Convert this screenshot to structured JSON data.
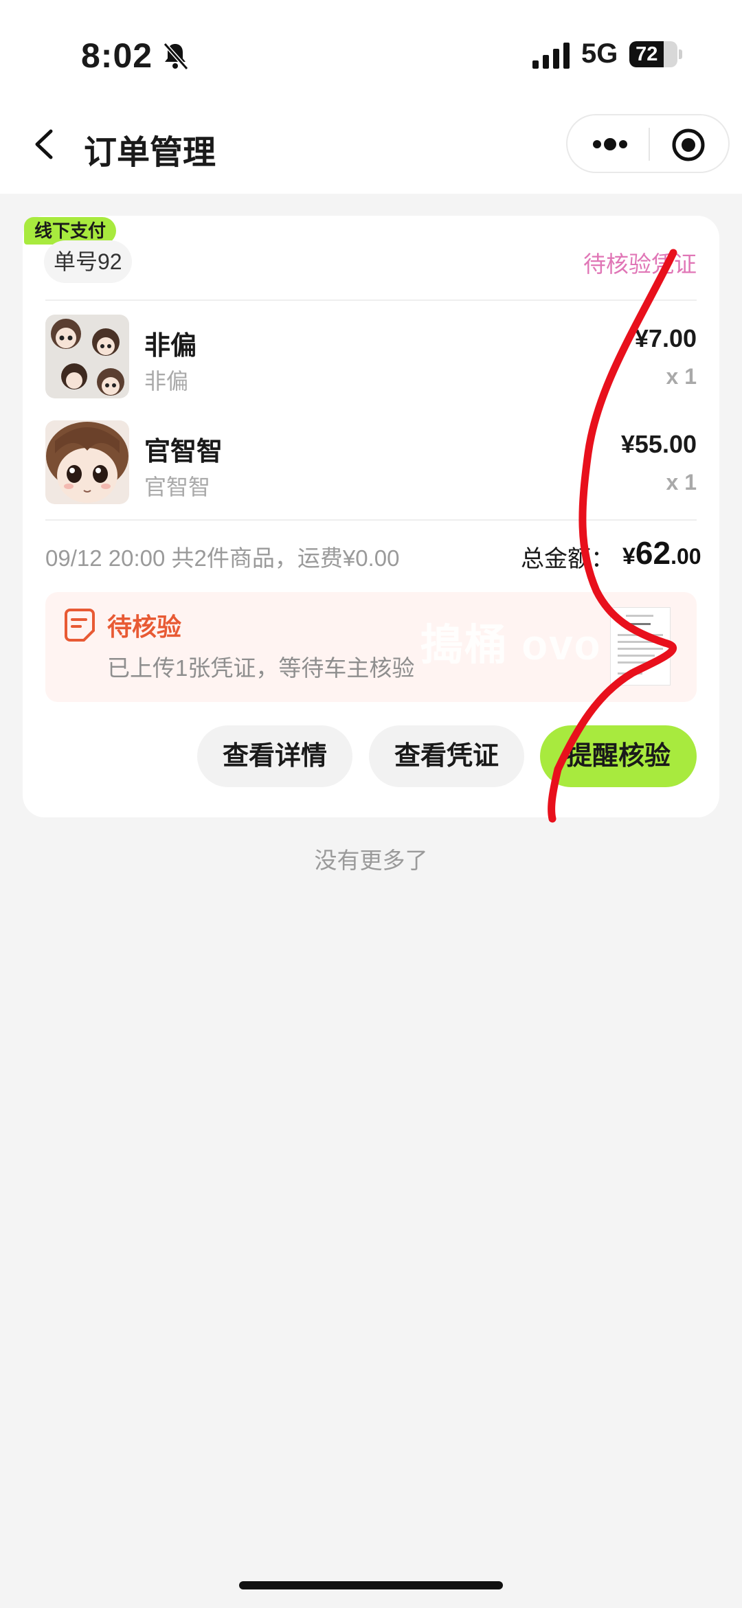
{
  "status_bar": {
    "time": "8:02",
    "network": "5G",
    "battery": "72",
    "battery_level": 0.72
  },
  "nav": {
    "title": "订单管理"
  },
  "order": {
    "payment_tag": "线下支付",
    "order_no": "单号92",
    "status": "待核验凭证",
    "items": [
      {
        "name": "非偏",
        "spec": "非偏",
        "price": "¥7.00",
        "qty": "x 1"
      },
      {
        "name": "官智智",
        "spec": "官智智",
        "price": "¥55.00",
        "qty": "x 1"
      }
    ],
    "summary": "09/12 20:00 共2件商品，运费¥0.00",
    "total_label": "总金额：",
    "total_symbol": "¥",
    "total_int": "62",
    "total_dec": ".00",
    "notice": {
      "title": "待核验",
      "desc": "已上传1张凭证，等待车主核验",
      "watermark": "搗桶 ovo"
    },
    "buttons": {
      "details": "查看详情",
      "voucher": "查看凭证",
      "remind": "提醒核验"
    }
  },
  "footer": {
    "no_more": "没有更多了"
  },
  "colors": {
    "accent_green": "#a8ea3e",
    "status_pink": "#e076b6",
    "notice_orange": "#e85a34",
    "annotation_red": "#e8101c"
  }
}
